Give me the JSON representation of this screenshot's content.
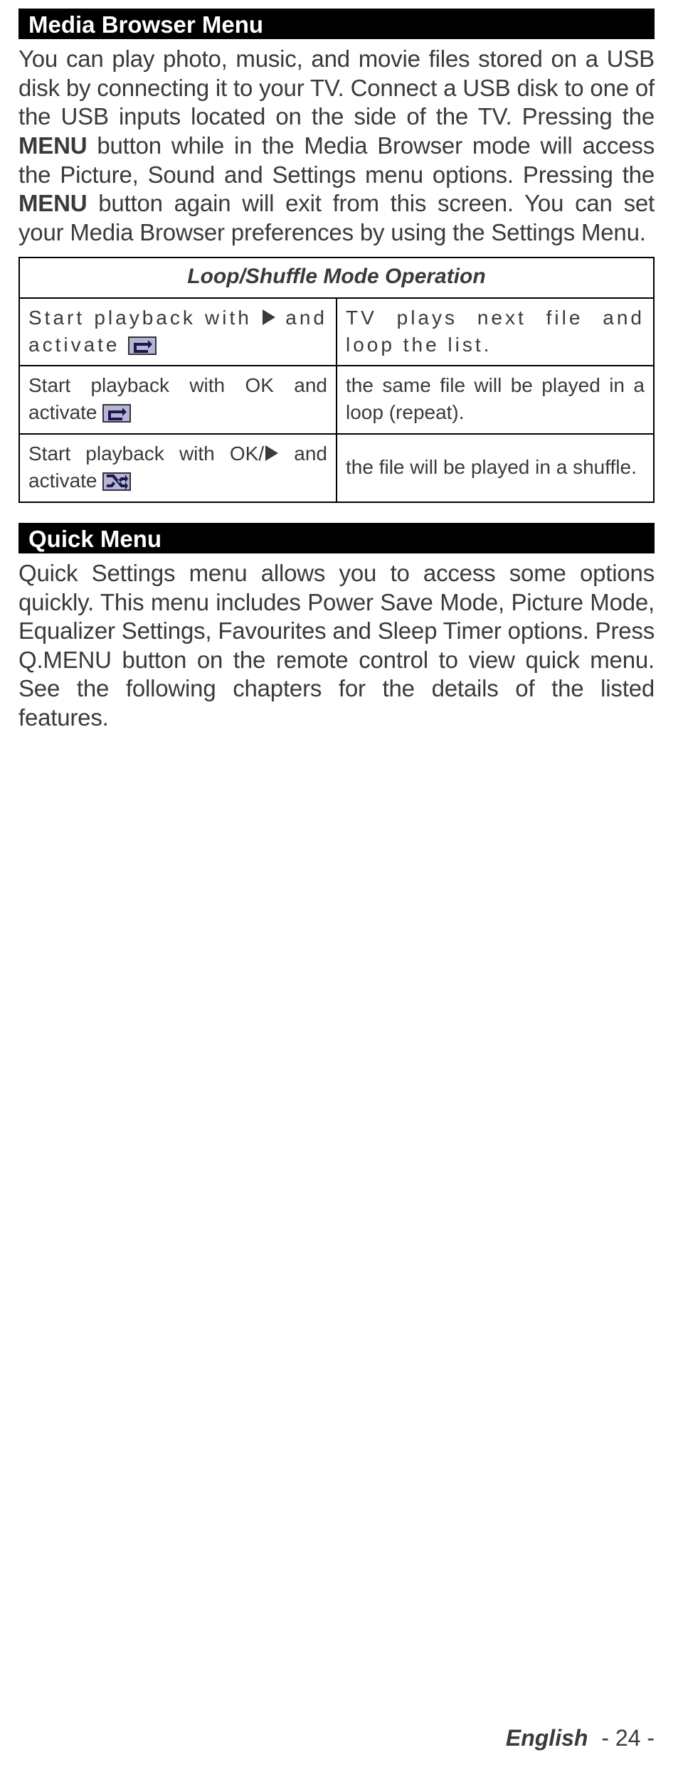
{
  "sections": {
    "media_heading": "Media Browser Menu",
    "media_body_plain_1": "You can play photo, music, and movie files stored on a USB disk by connecting it to your TV. Connect a USB disk to one of the USB inputs located on the side of the TV. Pressing the ",
    "media_body_strong_1": "MENU",
    "media_body_plain_2": " button while in the Media Browser mode will access the Picture, Sound and Settings menu options. Pressing the ",
    "media_body_strong_2": "MENU",
    "media_body_plain_3": " button again will exit from this screen. You can set your Media Browser preferences by using the Settings Menu.",
    "quick_heading": "Quick Menu",
    "quick_body": "Quick Settings menu allows you to access some options quickly. This menu includes Power Save Mode, Picture Mode, Equalizer Settings, Favourites and Sleep Timer options.  Press Q.MENU button on the remote control to view quick menu. See the following chapters for the details of the listed features."
  },
  "table": {
    "title": "Loop/Shuffle Mode Operation",
    "rows": [
      {
        "left_pre": "Start playback with ",
        "left_mid": " and activate ",
        "right": "TV plays next file and loop the list."
      },
      {
        "left_pre": "Start playback with OK and activate ",
        "right": "the same file will be played in a loop (repeat)."
      },
      {
        "left_pre": "Start playback with OK/",
        "left_mid": " and activate ",
        "right": "the file will be played in a shuffle."
      }
    ]
  },
  "footer": {
    "lang": "English",
    "page": "- 24 -"
  }
}
